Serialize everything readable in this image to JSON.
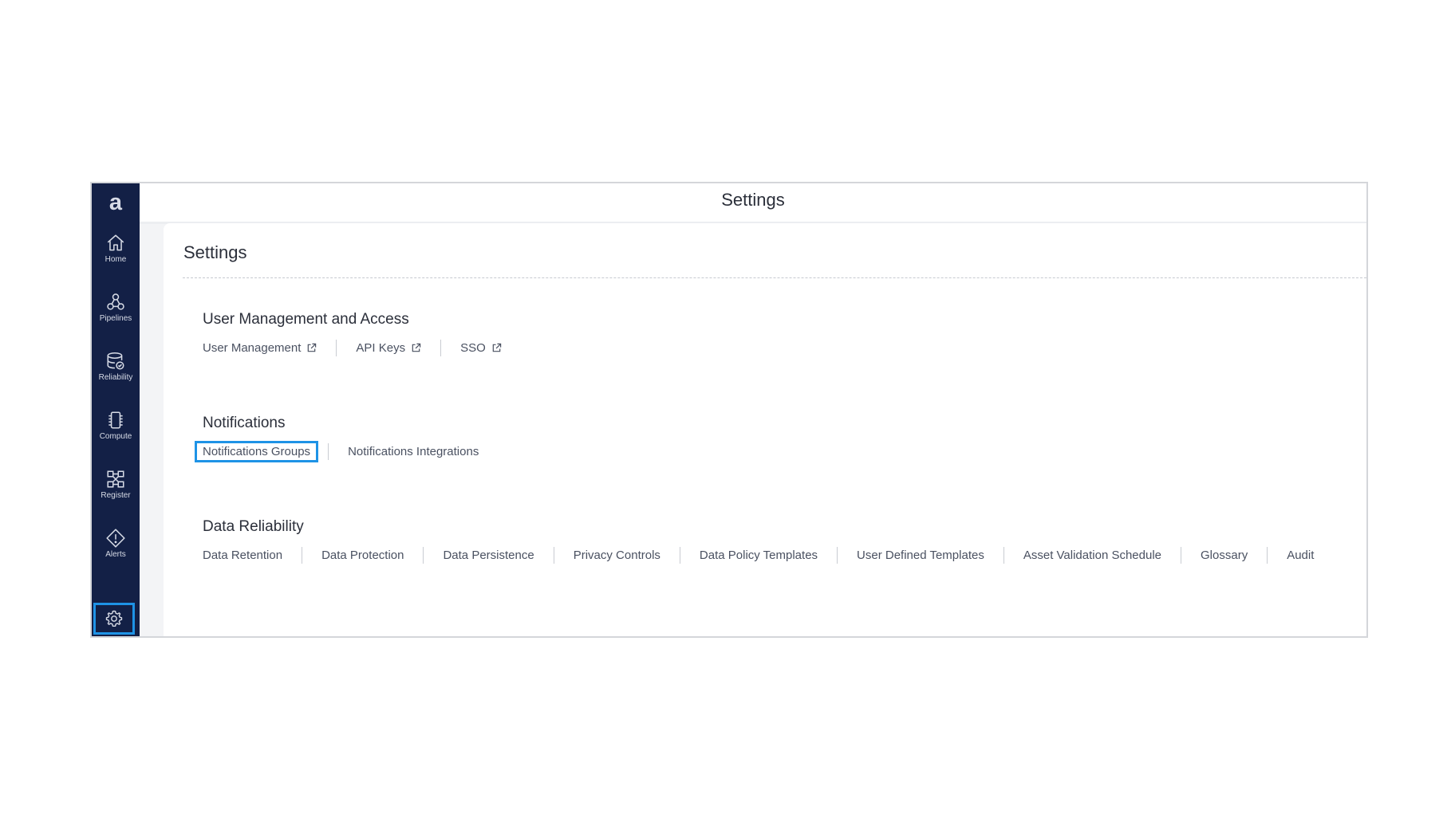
{
  "app": {
    "logo_text": "a",
    "top_title": "Settings",
    "page_title": "Settings"
  },
  "sidebar": {
    "items": [
      {
        "label": "Home",
        "icon": "home-icon"
      },
      {
        "label": "Pipelines",
        "icon": "pipelines-icon"
      },
      {
        "label": "Reliability",
        "icon": "reliability-icon"
      },
      {
        "label": "Compute",
        "icon": "compute-icon"
      },
      {
        "label": "Register",
        "icon": "register-icon"
      },
      {
        "label": "Alerts",
        "icon": "alerts-icon"
      }
    ],
    "settings_icon": "gear-icon"
  },
  "sections": {
    "user_management": {
      "title": "User Management and Access",
      "links": [
        {
          "label": "User Management",
          "external": true
        },
        {
          "label": "API Keys",
          "external": true
        },
        {
          "label": "SSO",
          "external": true
        }
      ]
    },
    "notifications": {
      "title": "Notifications",
      "links": [
        {
          "label": "Notifications Groups",
          "highlighted": true
        },
        {
          "label": "Notifications Integrations"
        }
      ]
    },
    "data_reliability": {
      "title": "Data Reliability",
      "links": [
        {
          "label": "Data Retention"
        },
        {
          "label": "Data Protection"
        },
        {
          "label": "Data Persistence"
        },
        {
          "label": "Privacy Controls"
        },
        {
          "label": "Data Policy Templates"
        },
        {
          "label": "User Defined Templates"
        },
        {
          "label": "Asset Validation Schedule"
        },
        {
          "label": "Glossary"
        },
        {
          "label": "Audit"
        }
      ]
    }
  },
  "colors": {
    "sidebar_bg": "#132046",
    "highlight": "#1e93e6"
  }
}
